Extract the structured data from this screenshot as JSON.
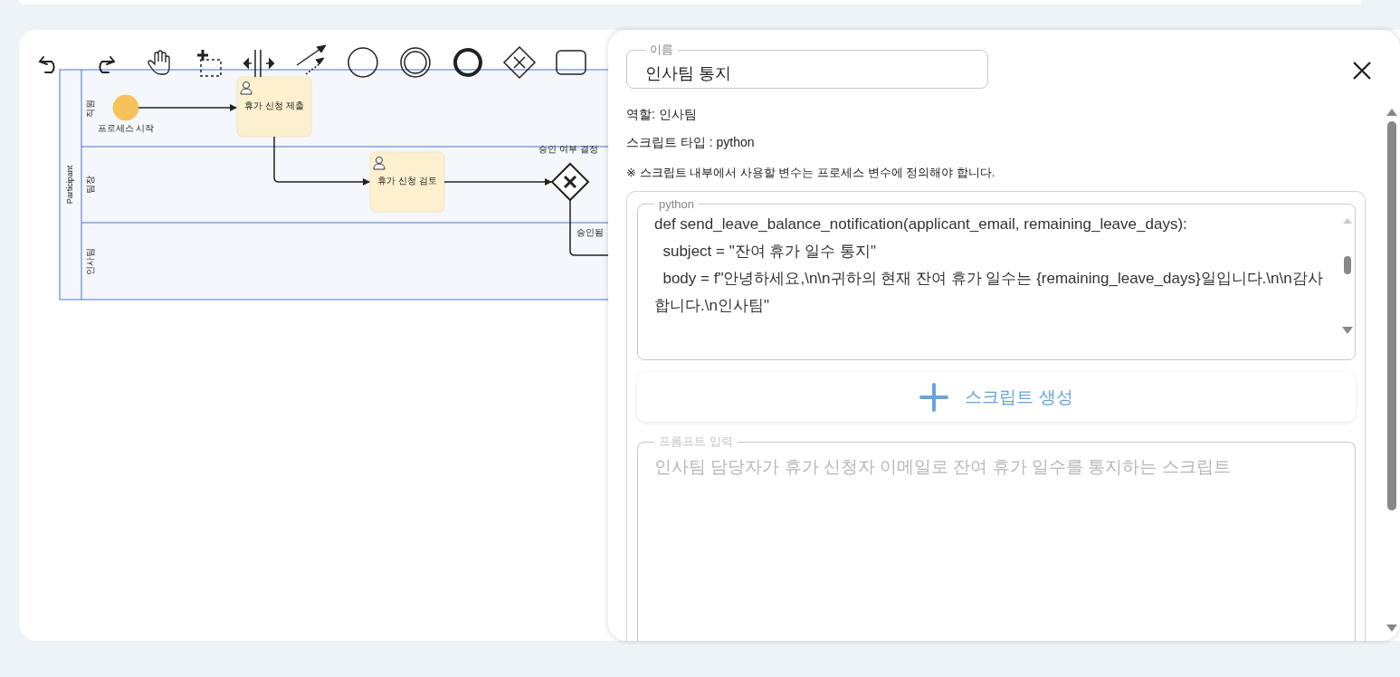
{
  "diagram": {
    "participant": "Participant",
    "lanes": [
      {
        "label": "직원"
      },
      {
        "label": "팀장"
      },
      {
        "label": "인사팀"
      }
    ],
    "nodes": [
      {
        "kind": "start_event",
        "label": "프로세스 시작"
      },
      {
        "kind": "user_task",
        "label": "휴가 신청 제출"
      },
      {
        "kind": "user_task",
        "label": "휴가 신청 검토"
      },
      {
        "kind": "exclusive_gateway",
        "label": "승인 여부 결정",
        "outgoing_label": "승인됨"
      }
    ]
  },
  "panel": {
    "name_field": {
      "label": "이름",
      "value": "인사팀 통지"
    },
    "role": "역할: 인사팀",
    "script_type": "스크립트 타입 : python",
    "note": "※ 스크립트 내부에서 사용할 변수는 프로세스 변수에 정의해야 합니다.",
    "code_field": {
      "label": "python",
      "value": "def send_leave_balance_notification(applicant_email, remaining_leave_days):\n  subject = \"잔여 휴가 일수 통지\"\n  body = f\"안녕하세요,\\n\\n귀하의 현재 잔여 휴가 일수는 {remaining_leave_days}일입니다.\\n\\n감사합니다.\\n인사팀\""
    },
    "generate_button": {
      "label": "스크립트 생성"
    },
    "prompt_field": {
      "label": "프롬프트 입력",
      "placeholder": "인사팀 담당자가 휴가 신청자 이메일로 잔여 휴가 일수를 통지하는 스크립트"
    }
  }
}
